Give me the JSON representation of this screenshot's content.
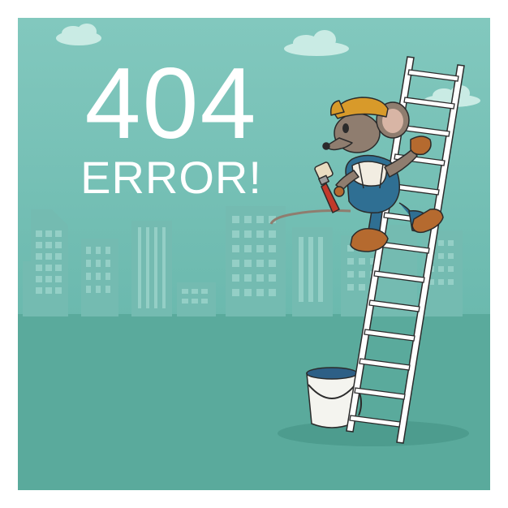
{
  "headline": {
    "code": "404",
    "message": "ERROR!"
  },
  "colors": {
    "background": "#5fb0a4",
    "sky_top": "#82c8be",
    "ground": "#5aaa9c",
    "buildings": "#74bbb1",
    "windows": "#9ad3ca",
    "text": "#ffffff",
    "mouse_fur": "#8f7d6f",
    "overalls": "#2f6f93",
    "hat": "#d89a2a",
    "boots": "#b56a2f",
    "ladder": "#ffffff",
    "paint": "#2d5f86"
  },
  "icons": [
    "cloud-icon",
    "mouse-painter-illustration",
    "ladder-illustration",
    "paint-bucket-icon",
    "paint-brush-icon",
    "city-skyline"
  ]
}
